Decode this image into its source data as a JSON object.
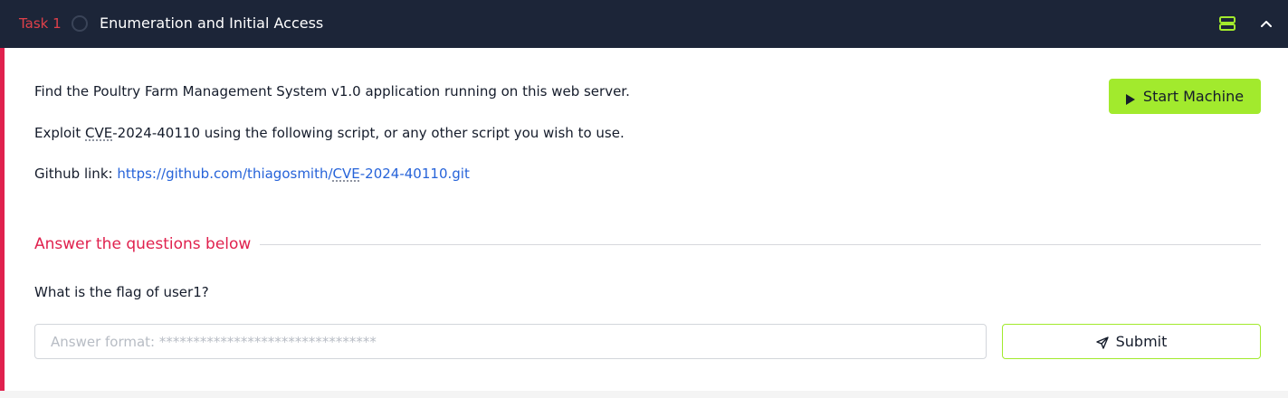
{
  "task": {
    "number_label": "Task 1",
    "title": "Enumeration and Initial Access",
    "status_icon": "circle-outline-icon",
    "header_icons": [
      "split-view-icon",
      "chevron-up-icon"
    ]
  },
  "content": {
    "line1": "Find the Poultry Farm Management System v1.0 application running on this web server.",
    "line2_prefix": "Exploit ",
    "line2_abbr": "CVE",
    "line2_suffix": "-2024-40110 using the following script, or any other script you wish to use.",
    "line3_prefix": "Github link: ",
    "link_part1": "https://github.com/thiagosmith/",
    "link_abbr": "CVE",
    "link_part2": "-2024-40110.git"
  },
  "start_machine": {
    "label": "Start Machine",
    "icon": "play-icon"
  },
  "answers": {
    "heading": "Answer the questions below",
    "question": "What is the flag of user1?",
    "input_value": "",
    "input_placeholder": "Answer format: ********************************",
    "submit_label": "Submit",
    "submit_icon": "send-icon"
  },
  "colors": {
    "header_bg": "#1c2538",
    "accent_red": "#e0214e",
    "task_number": "#e0404a",
    "lime": "#a2ea2d",
    "link": "#2663d9"
  }
}
